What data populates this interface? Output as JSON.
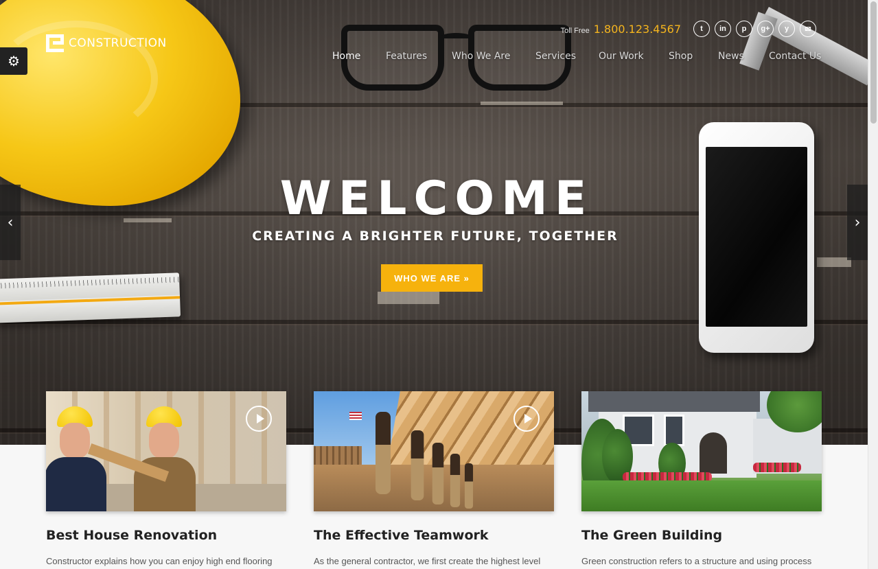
{
  "brand": {
    "logo_text": "CONSTRUCTION"
  },
  "header": {
    "tollfree_label": "Toll Free",
    "tollfree_number": "1.800.123.4567",
    "social": [
      {
        "name": "twitter",
        "glyph": "t"
      },
      {
        "name": "linkedin",
        "glyph": "in"
      },
      {
        "name": "pinterest",
        "glyph": "p"
      },
      {
        "name": "google-plus",
        "glyph": "g+"
      },
      {
        "name": "yelp",
        "glyph": "y"
      },
      {
        "name": "email",
        "glyph": "✉"
      }
    ]
  },
  "nav": {
    "items": [
      "Home",
      "Features",
      "Who We Are",
      "Services",
      "Our Work",
      "Shop",
      "News",
      "Contact Us"
    ],
    "active": "Home"
  },
  "hero": {
    "title": "WELCOME",
    "subtitle": "CREATING A BRIGHTER FUTURE, TOGETHER",
    "button": "WHO WE ARE »"
  },
  "slider": {
    "prev_glyph": "‹",
    "next_glyph": "›"
  },
  "settings": {
    "glyph": "⚙"
  },
  "cards": [
    {
      "title": "Best House Renovation",
      "text": "Constructor explains how you can enjoy high end flooring"
    },
    {
      "title": "The Effective Teamwork",
      "text": "As the general contractor, we first create the highest level"
    },
    {
      "title": "The Green Building",
      "text": "Green construction refers to a structure and using process"
    }
  ],
  "colors": {
    "accent": "#f6b20d",
    "phone_number": "#f5b51e"
  }
}
